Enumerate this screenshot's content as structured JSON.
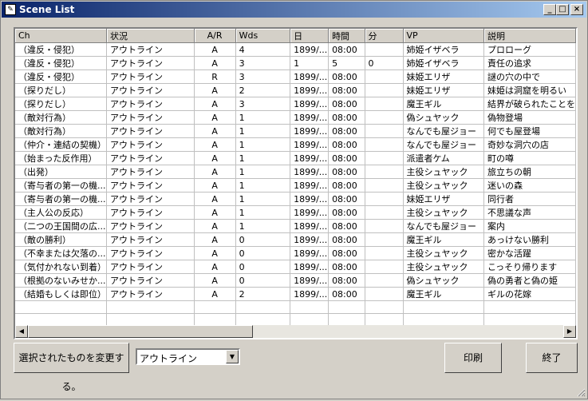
{
  "window": {
    "title": "Scene List",
    "app_icon": "book-icon"
  },
  "table": {
    "columns": [
      "Ch",
      "状況",
      "A/R",
      "Wds",
      "日",
      "時間",
      "分",
      "VP",
      "説明"
    ],
    "rows": [
      [
        "（違反・侵犯）",
        "アウトライン",
        "A",
        "4",
        "1899/...",
        "08:00",
        "",
        "姉姫イザベラ",
        "プロローグ"
      ],
      [
        "（違反・侵犯）",
        "アウトライン",
        "A",
        "3",
        "1",
        "5",
        "0",
        "姉姫イザベラ",
        "責任の追求"
      ],
      [
        "（違反・侵犯）",
        "アウトライン",
        "R",
        "3",
        "1899/...",
        "08:00",
        "",
        "妹姫エリザ",
        "謎の穴の中で"
      ],
      [
        "（探りだし）",
        "アウトライン",
        "A",
        "2",
        "1899/...",
        "08:00",
        "",
        "妹姫エリザ",
        "妹姫は洞窟を明るい"
      ],
      [
        "（探りだし）",
        "アウトライン",
        "A",
        "3",
        "1899/...",
        "08:00",
        "",
        "魔王ギル",
        "結界が破られたことを"
      ],
      [
        "（敵対行為）",
        "アウトライン",
        "A",
        "1",
        "1899/...",
        "08:00",
        "",
        "偽シュヤック",
        "偽物登場"
      ],
      [
        "（敵対行為）",
        "アウトライン",
        "A",
        "1",
        "1899/...",
        "08:00",
        "",
        "なんでも屋ジョー",
        "何でも屋登場"
      ],
      [
        "（仲介・連結の契機）",
        "アウトライン",
        "A",
        "1",
        "1899/...",
        "08:00",
        "",
        "なんでも屋ジョー",
        "奇妙な洞穴の店"
      ],
      [
        "（始まった反作用）",
        "アウトライン",
        "A",
        "1",
        "1899/...",
        "08:00",
        "",
        "派遣者ケム",
        "町の噂"
      ],
      [
        "（出発）",
        "アウトライン",
        "A",
        "1",
        "1899/...",
        "08:00",
        "",
        "主役シュヤック",
        "旅立ちの朝"
      ],
      [
        "（寄与者の第一の機...",
        "アウトライン",
        "A",
        "1",
        "1899/...",
        "08:00",
        "",
        "主役シュヤック",
        "迷いの森"
      ],
      [
        "（寄与者の第一の機...",
        "アウトライン",
        "A",
        "1",
        "1899/...",
        "08:00",
        "",
        "妹姫エリザ",
        "同行者"
      ],
      [
        "（主人公の反応）",
        "アウトライン",
        "A",
        "1",
        "1899/...",
        "08:00",
        "",
        "主役シュヤック",
        "不思議な声"
      ],
      [
        "（二つの王国間の広...",
        "アウトライン",
        "A",
        "1",
        "1899/...",
        "08:00",
        "",
        "なんでも屋ジョー",
        "案内"
      ],
      [
        "（敵の勝利）",
        "アウトライン",
        "A",
        "0",
        "1899/...",
        "08:00",
        "",
        "魔王ギル",
        "あっけない勝利"
      ],
      [
        "（不幸または欠落の...",
        "アウトライン",
        "A",
        "0",
        "1899/...",
        "08:00",
        "",
        "主役シュヤック",
        "密かな活躍"
      ],
      [
        "（気付かれない到着）",
        "アウトライン",
        "A",
        "0",
        "1899/...",
        "08:00",
        "",
        "主役シュヤック",
        "こっそり帰ります"
      ],
      [
        "（根拠のないみせか...",
        "アウトライン",
        "A",
        "0",
        "1899/...",
        "08:00",
        "",
        "偽シュヤック",
        "偽の勇者と偽の姫"
      ],
      [
        "（結婚もしくは即位）",
        "アウトライン",
        "A",
        "2",
        "1899/...",
        "08:00",
        "",
        "魔王ギル",
        "ギルの花嫁"
      ]
    ]
  },
  "footer": {
    "change_button": "選択されたものを変更する。",
    "status_select": "アウトライン",
    "print_button": "印刷",
    "exit_button": "終了"
  }
}
